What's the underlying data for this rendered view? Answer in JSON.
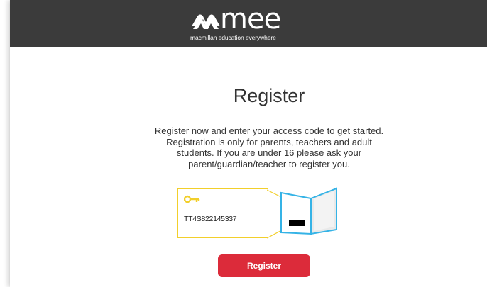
{
  "header": {
    "logo_word": "mee",
    "logo_tagline": "macmillan education everywhere"
  },
  "main": {
    "title": "Register",
    "intro": "Register now and enter your access code to get started. Registration is only for parents, teachers and adult students. If you are under 16 please ask your parent/guardian/teacher to register you.",
    "code_card": {
      "sample_code": "TT4S822145337"
    },
    "register_button": "Register"
  },
  "colors": {
    "header_bg": "#3b3b3b",
    "accent_red": "#dc2b3a",
    "key_yellow": "#f2cf2b",
    "book_blue": "#35b3e6"
  },
  "icons": [
    "mee-logo-icon",
    "key-icon",
    "book-icon"
  ]
}
